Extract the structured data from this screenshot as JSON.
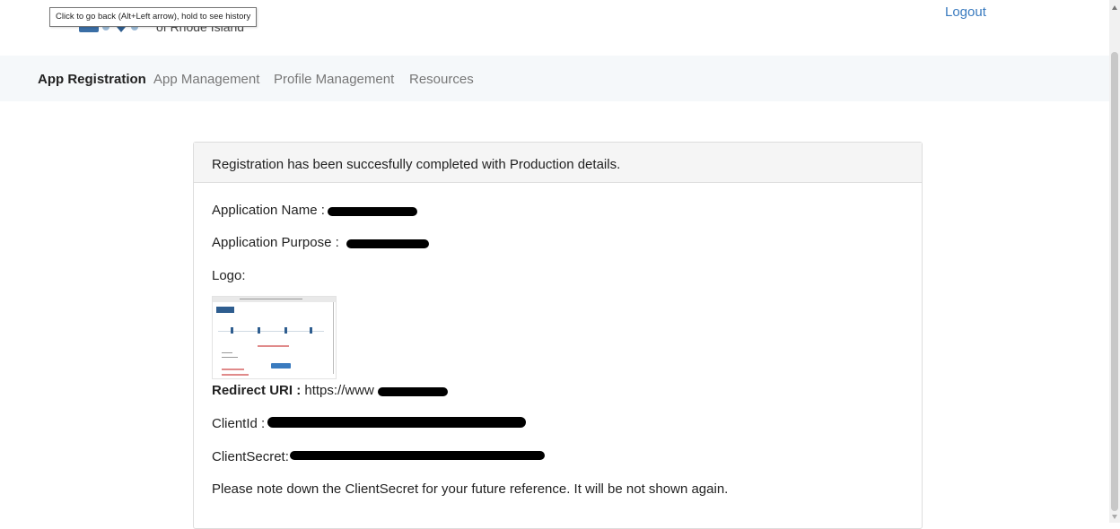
{
  "header": {
    "logo_text": "of Rhode Island",
    "tooltip": "Click to go back (Alt+Left arrow), hold to see history",
    "logout_label": "Logout"
  },
  "nav": {
    "items": [
      {
        "label": "App Registration",
        "active": true
      },
      {
        "label": "App Management",
        "active": false
      },
      {
        "label": "Profile Management",
        "active": false
      },
      {
        "label": "Resources",
        "active": false
      }
    ]
  },
  "panel": {
    "title": "Registration has been succesfully completed with Production details.",
    "application_name_label": "Application Name :",
    "application_purpose_label": "Application Purpose :",
    "logo_label": "Logo:",
    "redirect_label": "Redirect URI :",
    "redirect_value": "https://www",
    "client_id_label": "ClientId :",
    "client_secret_label": "ClientSecret:",
    "note": "Please note down the ClientSecret for your future reference. It will be not shown again."
  },
  "colors": {
    "link": "#3a7bbf",
    "nav_bg": "#f5f8fa",
    "panel_heading_bg": "#f5f5f5",
    "redaction": "#000000"
  },
  "icons": [
    "scroll-up-arrow-icon",
    "scroll-down-arrow-icon"
  ]
}
